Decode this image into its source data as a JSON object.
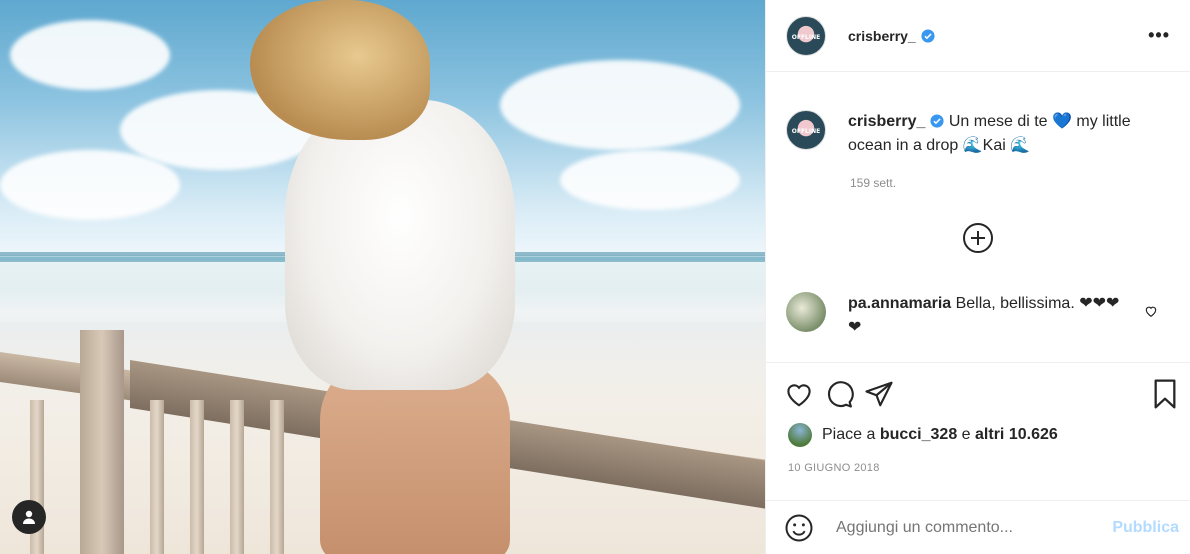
{
  "header": {
    "username": "crisberry_",
    "avatar_text": "OFFLINE",
    "more_label": "•••"
  },
  "caption": {
    "username": "crisberry_",
    "text": "Un mese di te 💙 my little ocean in a drop 🌊Kai 🌊",
    "time": "159 sett."
  },
  "comments": [
    {
      "username": "pa.annamaria",
      "text": "Bella, bellissima. ❤❤❤❤"
    }
  ],
  "likes": {
    "prefix": "Piace a ",
    "user": "bucci_328",
    "middle": " e ",
    "others": "altri 10.626"
  },
  "date": "10 GIUGNO 2018",
  "add_comment": {
    "placeholder": "Aggiungi un commento...",
    "publish_label": "Pubblica"
  },
  "colors": {
    "verified": "#3897f0",
    "heart": "#ed4956",
    "publish": "#b3dbff"
  },
  "icons": [
    "verified-badge-icon",
    "more-options-icon",
    "load-more-comments-icon",
    "heart-icon",
    "comment-icon",
    "share-icon",
    "bookmark-icon",
    "emoji-icon",
    "user-tag-icon"
  ]
}
